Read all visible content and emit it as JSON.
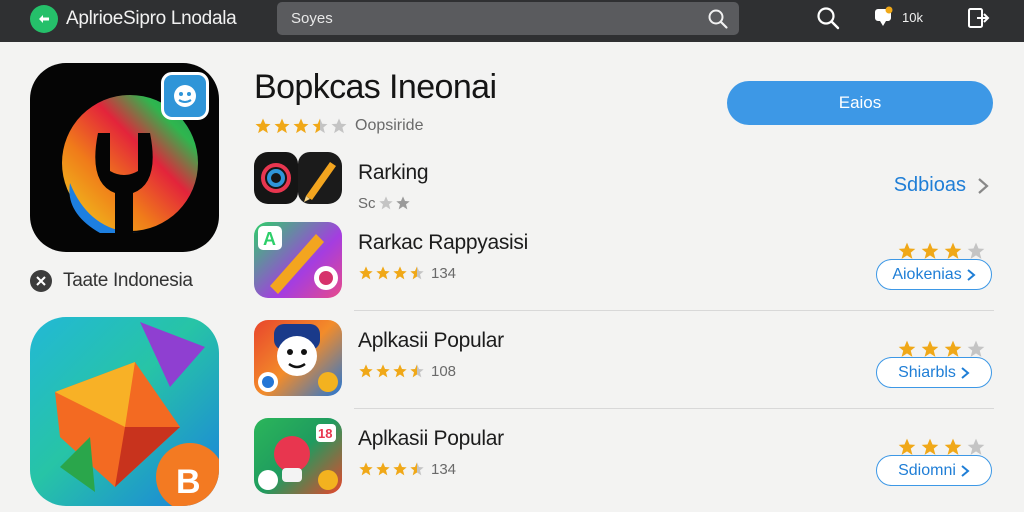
{
  "topbar": {
    "app_title": "AplrioeSipro Lnodala",
    "search_placeholder": "Soyes",
    "badge_label": "10k",
    "icons": [
      "logo-icon",
      "search-icon",
      "badge-icon",
      "exit-icon"
    ]
  },
  "app": {
    "name": "Bopkcas Ineonai",
    "rating_stars": 3.5,
    "rating_label": "Oopsiride",
    "action_label": "Eaios",
    "developer": "Taate Indonesia"
  },
  "list": {
    "see_all_label": "Sdbioas",
    "items": [
      {
        "name": "Rarking",
        "rating_stars": 2.5,
        "count": "",
        "right_stars": 0,
        "button_label": ""
      },
      {
        "name": "Rarkac Rappyasisi",
        "rating_stars": 3.5,
        "count": "134",
        "right_stars": 3,
        "button_label": "Aiokenias"
      },
      {
        "name": "Aplkasii Popular",
        "rating_stars": 3.5,
        "count": "108",
        "right_stars": 3,
        "button_label": "Shiarbls"
      },
      {
        "name": "Aplkasii Popular",
        "rating_stars": 3.5,
        "count": "134",
        "right_stars": 3,
        "button_label": "Sdiomni"
      }
    ]
  },
  "colors": {
    "accent": "#3d98e6",
    "link": "#1f7ed6",
    "star_filled": "#f0a818",
    "star_empty": "#c4c4c4",
    "topbar": "#2f3032",
    "logo": "#25c06a"
  }
}
